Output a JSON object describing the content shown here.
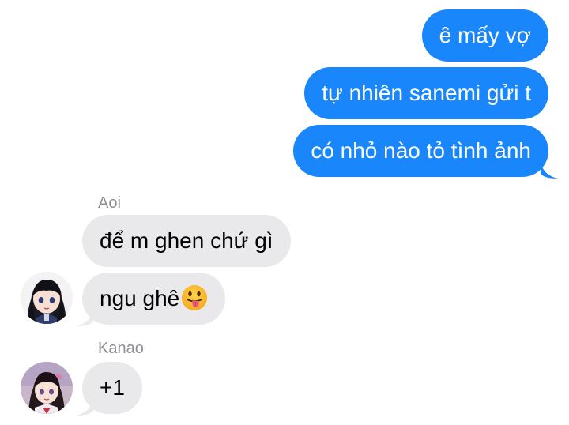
{
  "conversation": {
    "outgoing": [
      {
        "text": "ê mấy vợ"
      },
      {
        "text": "tự nhiên sanemi gửi t"
      },
      {
        "text": "có nhỏ nào tỏ tình ảnh"
      }
    ],
    "groups": [
      {
        "sender": "Aoi",
        "avatar_icon": "aoi-avatar-icon",
        "messages": [
          {
            "text": "để m ghen chứ gì"
          },
          {
            "text": "ngu ghê",
            "emoji": "tongue-out-emoji-icon"
          }
        ]
      },
      {
        "sender": "Kanao",
        "avatar_icon": "kanao-avatar-icon",
        "messages": [
          {
            "text": "+1"
          }
        ]
      }
    ]
  },
  "colors": {
    "outgoing_bubble": "#1a86fb",
    "incoming_bubble": "#e9e9eb",
    "sender_label": "#8e8e93"
  }
}
